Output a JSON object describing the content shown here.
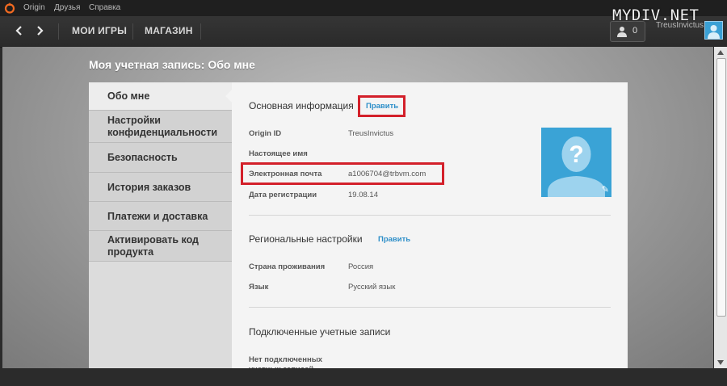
{
  "menubar": {
    "items": [
      "Origin",
      "Друзья",
      "Справка"
    ]
  },
  "toolbar": {
    "my_games": "МОИ ИГРЫ",
    "store": "МАГАЗИН",
    "friends_count": "0",
    "username": "TreusInvictus"
  },
  "watermark": "MYDIV.NET",
  "page": {
    "title": "Моя учетная запись: Обо мне"
  },
  "sidebar": {
    "items": [
      {
        "label": "Обо мне",
        "active": true
      },
      {
        "label": "Настройки конфиденциальности"
      },
      {
        "label": "Безопасность"
      },
      {
        "label": "История заказов"
      },
      {
        "label": "Платежи и доставка"
      },
      {
        "label": "Активировать код продукта"
      }
    ]
  },
  "basic_info": {
    "title": "Основная информация",
    "edit": "Править",
    "fields": [
      {
        "label": "Origin ID",
        "value": "TreusInvictus"
      },
      {
        "label": "Настоящее имя",
        "value": ""
      },
      {
        "label": "Электронная почта",
        "value": "a1006704@trbvm.com"
      },
      {
        "label": "Дата регистрации",
        "value": "19.08.14"
      }
    ]
  },
  "regional": {
    "title": "Региональные настройки",
    "edit": "Править",
    "fields": [
      {
        "label": "Страна проживания",
        "value": "Россия"
      },
      {
        "label": "Язык",
        "value": "Русский язык"
      }
    ]
  },
  "connected": {
    "title": "Подключенные учетные записи",
    "empty_text": "Нет подключенных учетных записей"
  },
  "colors": {
    "accent": "#2e8fc9",
    "highlight": "#d3202a",
    "avatar": "#3aa3d6"
  }
}
